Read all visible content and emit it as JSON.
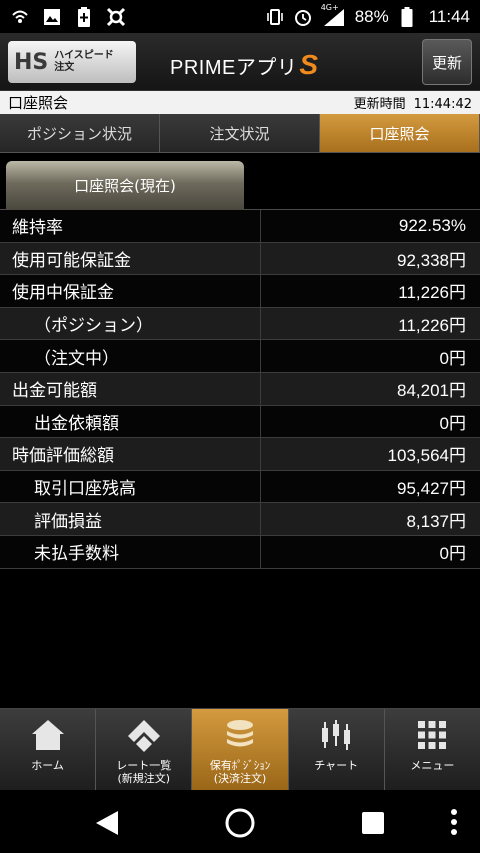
{
  "status_bar": {
    "icons_left": [
      "wifi-calling-icon",
      "image-icon",
      "battery-saver-icon",
      "app-icon"
    ],
    "battery_percent": "88%",
    "time": "11:44",
    "network": "4G+"
  },
  "header": {
    "logo_text_hs": "HS",
    "logo_sub_line1": "ハイスピード",
    "logo_sub_line2": "注文",
    "app_name": "PRIMEアプリ",
    "app_name_suffix": "S",
    "refresh_label": "更新"
  },
  "title_row": {
    "title": "口座照会",
    "updated_label": "更新時間",
    "updated_time": "11:44:42"
  },
  "tabs": [
    {
      "label": "ポジション状況",
      "active": false
    },
    {
      "label": "注文状況",
      "active": false
    },
    {
      "label": "口座照会",
      "active": true
    }
  ],
  "subtab": {
    "label": "口座照会(現在)"
  },
  "account_rows": [
    {
      "label": "維持率",
      "value": "922.53%"
    },
    {
      "label": "使用可能保証金",
      "value": "92,338円"
    },
    {
      "label": "使用中保証金",
      "value": "11,226円"
    },
    {
      "label": "（ポジション）",
      "value": "11,226円"
    },
    {
      "label": "（注文中）",
      "value": "0円"
    },
    {
      "label": "出金可能額",
      "value": "84,201円"
    },
    {
      "label": "出金依頼額",
      "value": "0円"
    },
    {
      "label": "時価評価総額",
      "value": "103,564円"
    },
    {
      "label": "取引口座残高",
      "value": "95,427円"
    },
    {
      "label": "評価損益",
      "value": "8,137円"
    },
    {
      "label": "未払手数料",
      "value": "0円"
    }
  ],
  "bottom_nav": [
    {
      "label": "ホーム",
      "icon": "home-icon",
      "active": false
    },
    {
      "label": "レート一覧\n(新規注文)",
      "icon": "rate-list-icon",
      "active": false
    },
    {
      "label": "保有ﾎﾟｼﾞｼｮﾝ\n(決済注文)",
      "icon": "coins-icon",
      "active": true
    },
    {
      "label": "チャート",
      "icon": "candlestick-chart-icon",
      "active": false
    },
    {
      "label": "メニュー",
      "icon": "grid-menu-icon",
      "active": false
    }
  ],
  "colors": {
    "accent_gold": "#c08a30",
    "background": "#000000"
  }
}
